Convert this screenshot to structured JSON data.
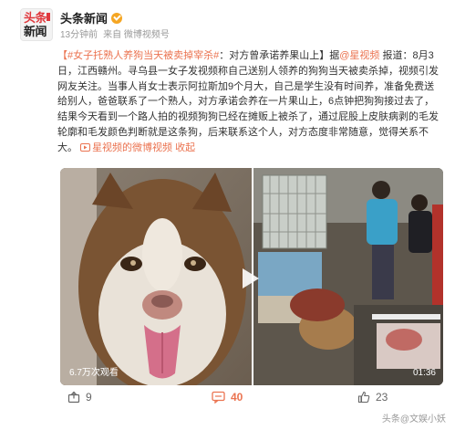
{
  "account": {
    "logo_line1": "头条",
    "logo_line2": "新闻",
    "name": "头条新闻",
    "time": "13分钟前",
    "source": "来自 微博视频号"
  },
  "post": {
    "hashtag": "【#女子托熟人养狗当天被卖掉宰杀#",
    "headline": "：对方曾承诺养果山上】",
    "via_prefix": "据",
    "via_link": "@星视频",
    "via_suffix": " 报道：",
    "body": "8月3日，江西赣州。寻乌县一女子发视频称自己送别人领养的狗狗当天被卖杀掉，视频引发网友关注。当事人肖女士表示阿拉斯加9个月大，自己是学生没有时间养，准备免费送给别人，爸爸联系了一个熟人，对方承诺会养在一片果山上，6点钟把狗狗接过去了，结果今天看到一个路人拍的视频狗狗已经在摊贩上被杀了，通过屁股上皮肤病剥的毛发轮廓和毛发颜色判断就是这条狗，后来联系这个人，对方态度非常随意，觉得关系不大。",
    "video_link": "星视频的微博视频",
    "collapse_label": "收起"
  },
  "media": {
    "views": "6.7万次观看",
    "duration": "01:36"
  },
  "actions": {
    "shares": "9",
    "comments": "40",
    "likes": "23"
  },
  "watermark": "头条@文娱小妖",
  "colors": {
    "accent": "#eb7350",
    "verify": "#f5a623",
    "logo_red": "#e0393e"
  }
}
